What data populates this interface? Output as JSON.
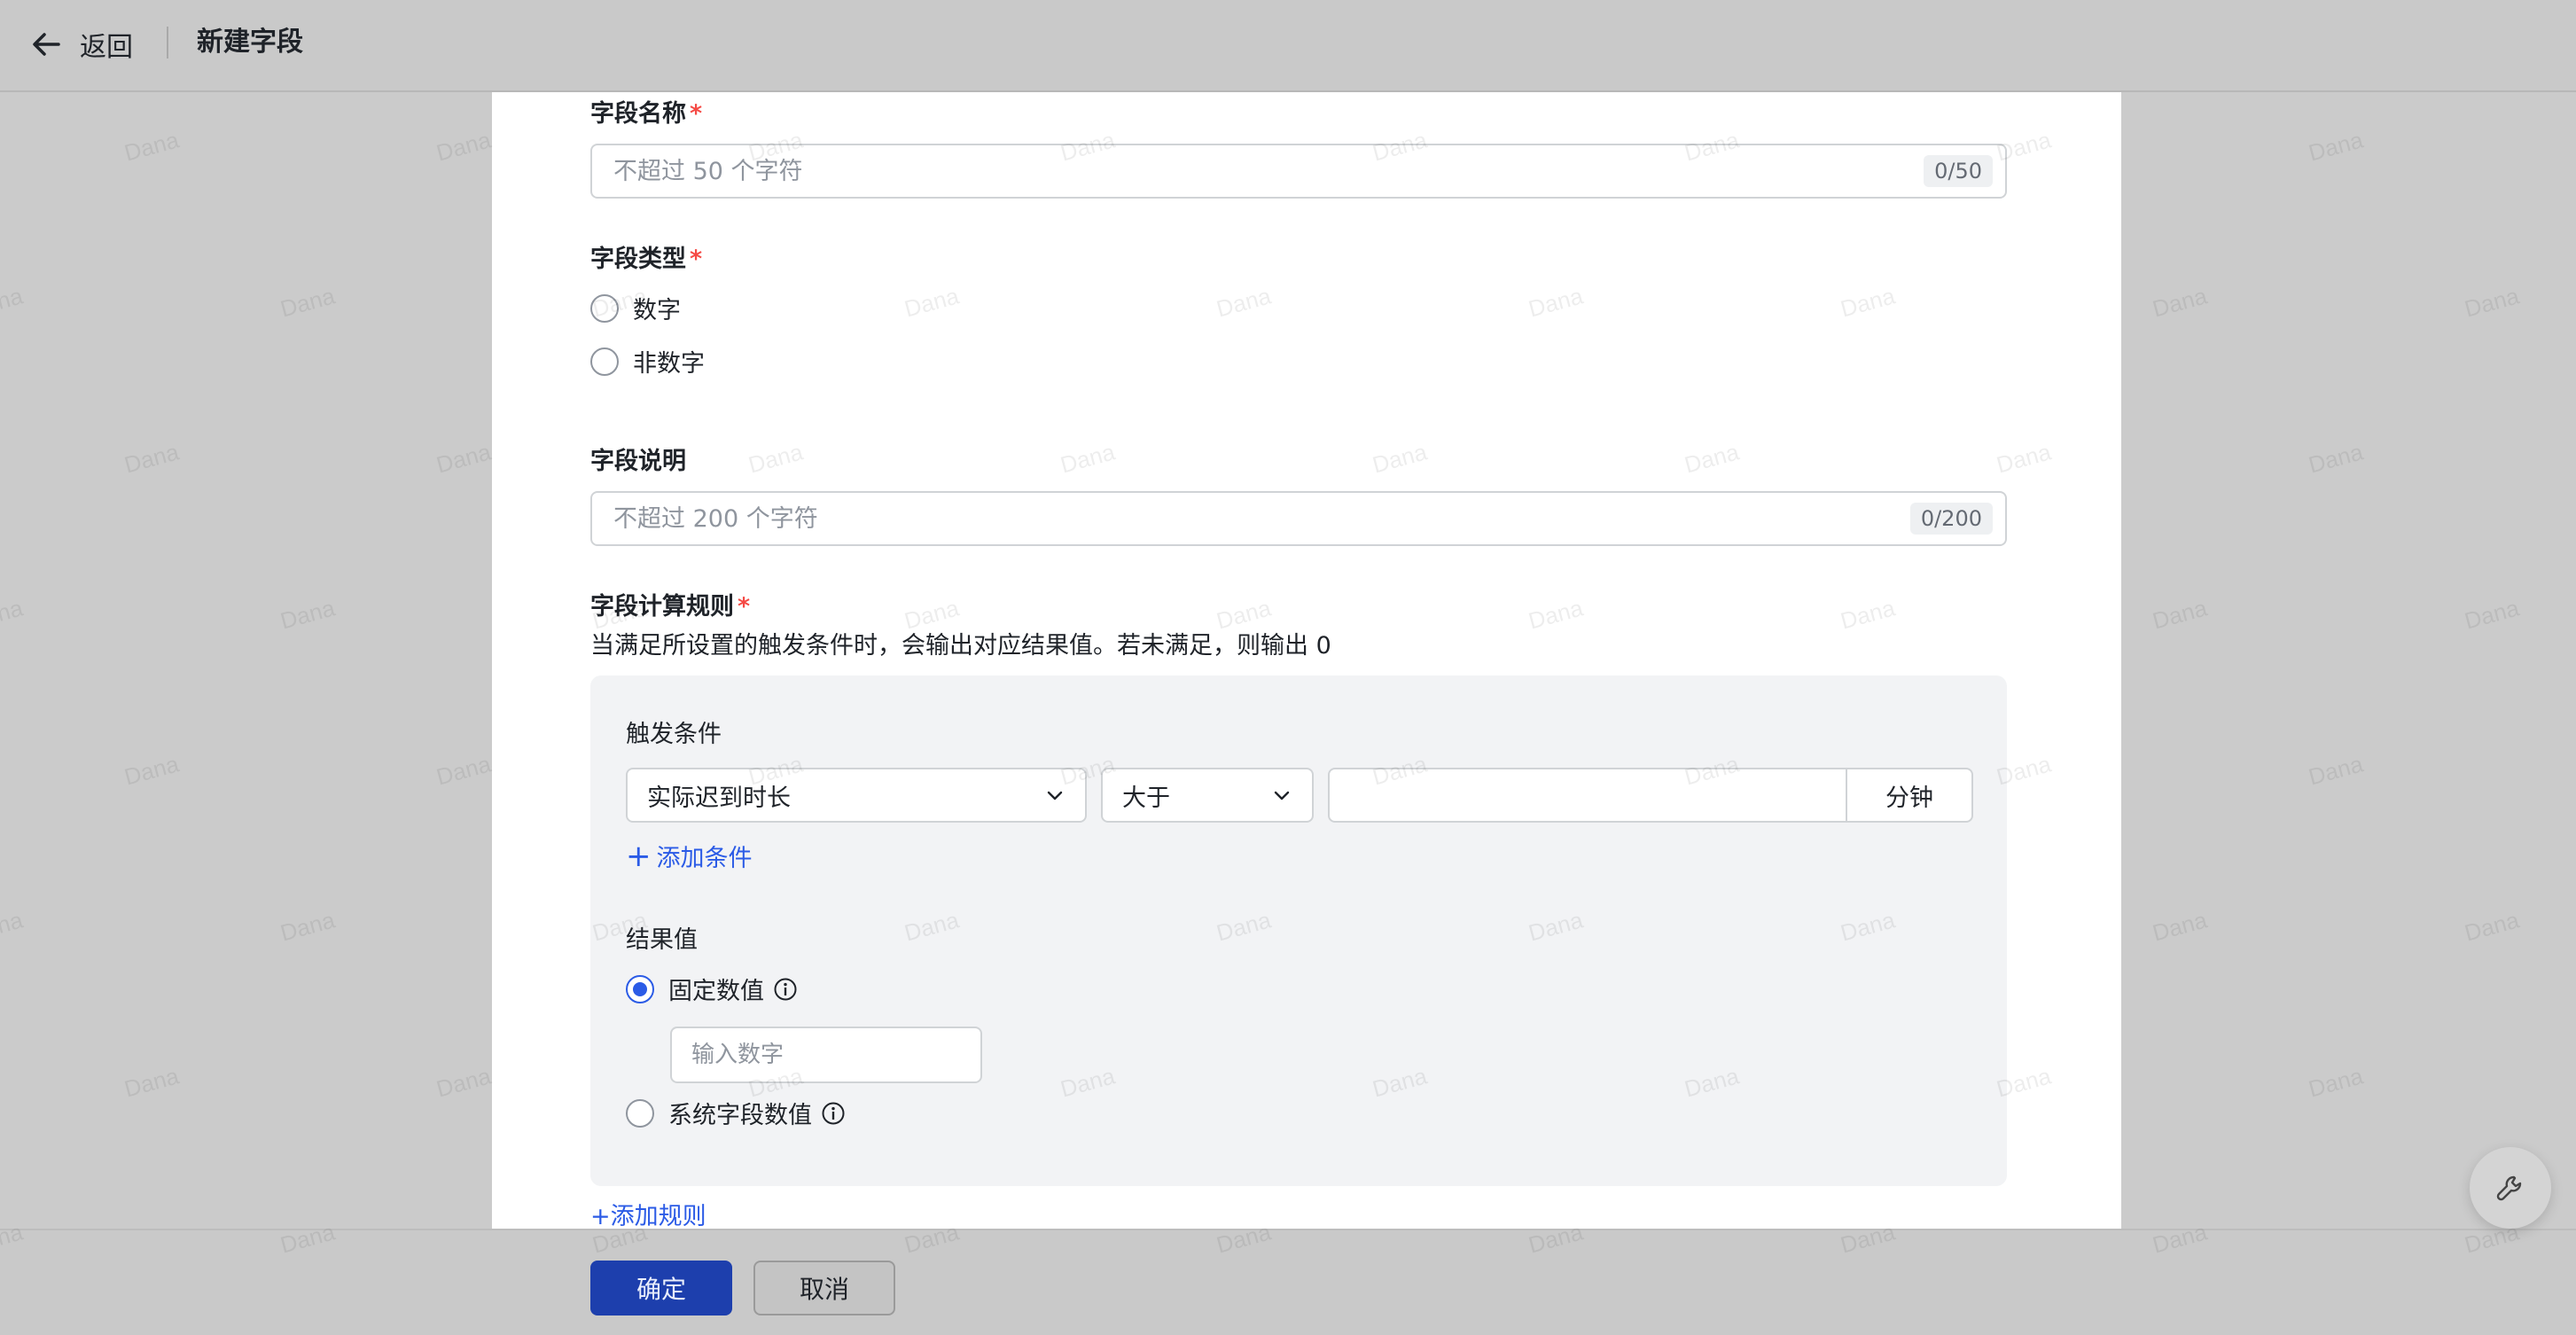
{
  "header": {
    "back_label": "返回",
    "title": "新建字段"
  },
  "watermark": "Dana",
  "form": {
    "name": {
      "label": "字段名称",
      "required_mark": "*",
      "placeholder": "不超过 50 个字符",
      "counter": "0/50",
      "value": ""
    },
    "type": {
      "label": "字段类型",
      "required_mark": "*",
      "options": [
        "数字",
        "非数字"
      ],
      "selected": null
    },
    "description": {
      "label": "字段说明",
      "placeholder": "不超过 200 个字符",
      "counter": "0/200",
      "value": ""
    },
    "calc_rule": {
      "label": "字段计算规则",
      "required_mark": "*",
      "desc": "当满足所设置的触发条件时，会输出对应结果值。若未满足，则输出 0",
      "trigger": {
        "label": "触发条件",
        "field": "实际迟到时长",
        "operator": "大于",
        "value": "",
        "unit": "分钟",
        "add_condition": "添加条件"
      },
      "result": {
        "label": "结果值",
        "option_fixed": "固定数值",
        "fixed_placeholder": "输入数字",
        "option_system": "系统字段数值",
        "selected": "固定数值"
      },
      "add_rule": "+添加规则"
    }
  },
  "footer": {
    "confirm": "确定",
    "cancel": "取消"
  },
  "colors": {
    "accent": "#2b5be6",
    "required": "#f54a45",
    "primary_button": "#1d3fad"
  },
  "icons": {
    "back": "arrow-left-icon",
    "dropdown": "chevron-down-icon",
    "info": "info-icon",
    "float": "wrench-icon"
  }
}
